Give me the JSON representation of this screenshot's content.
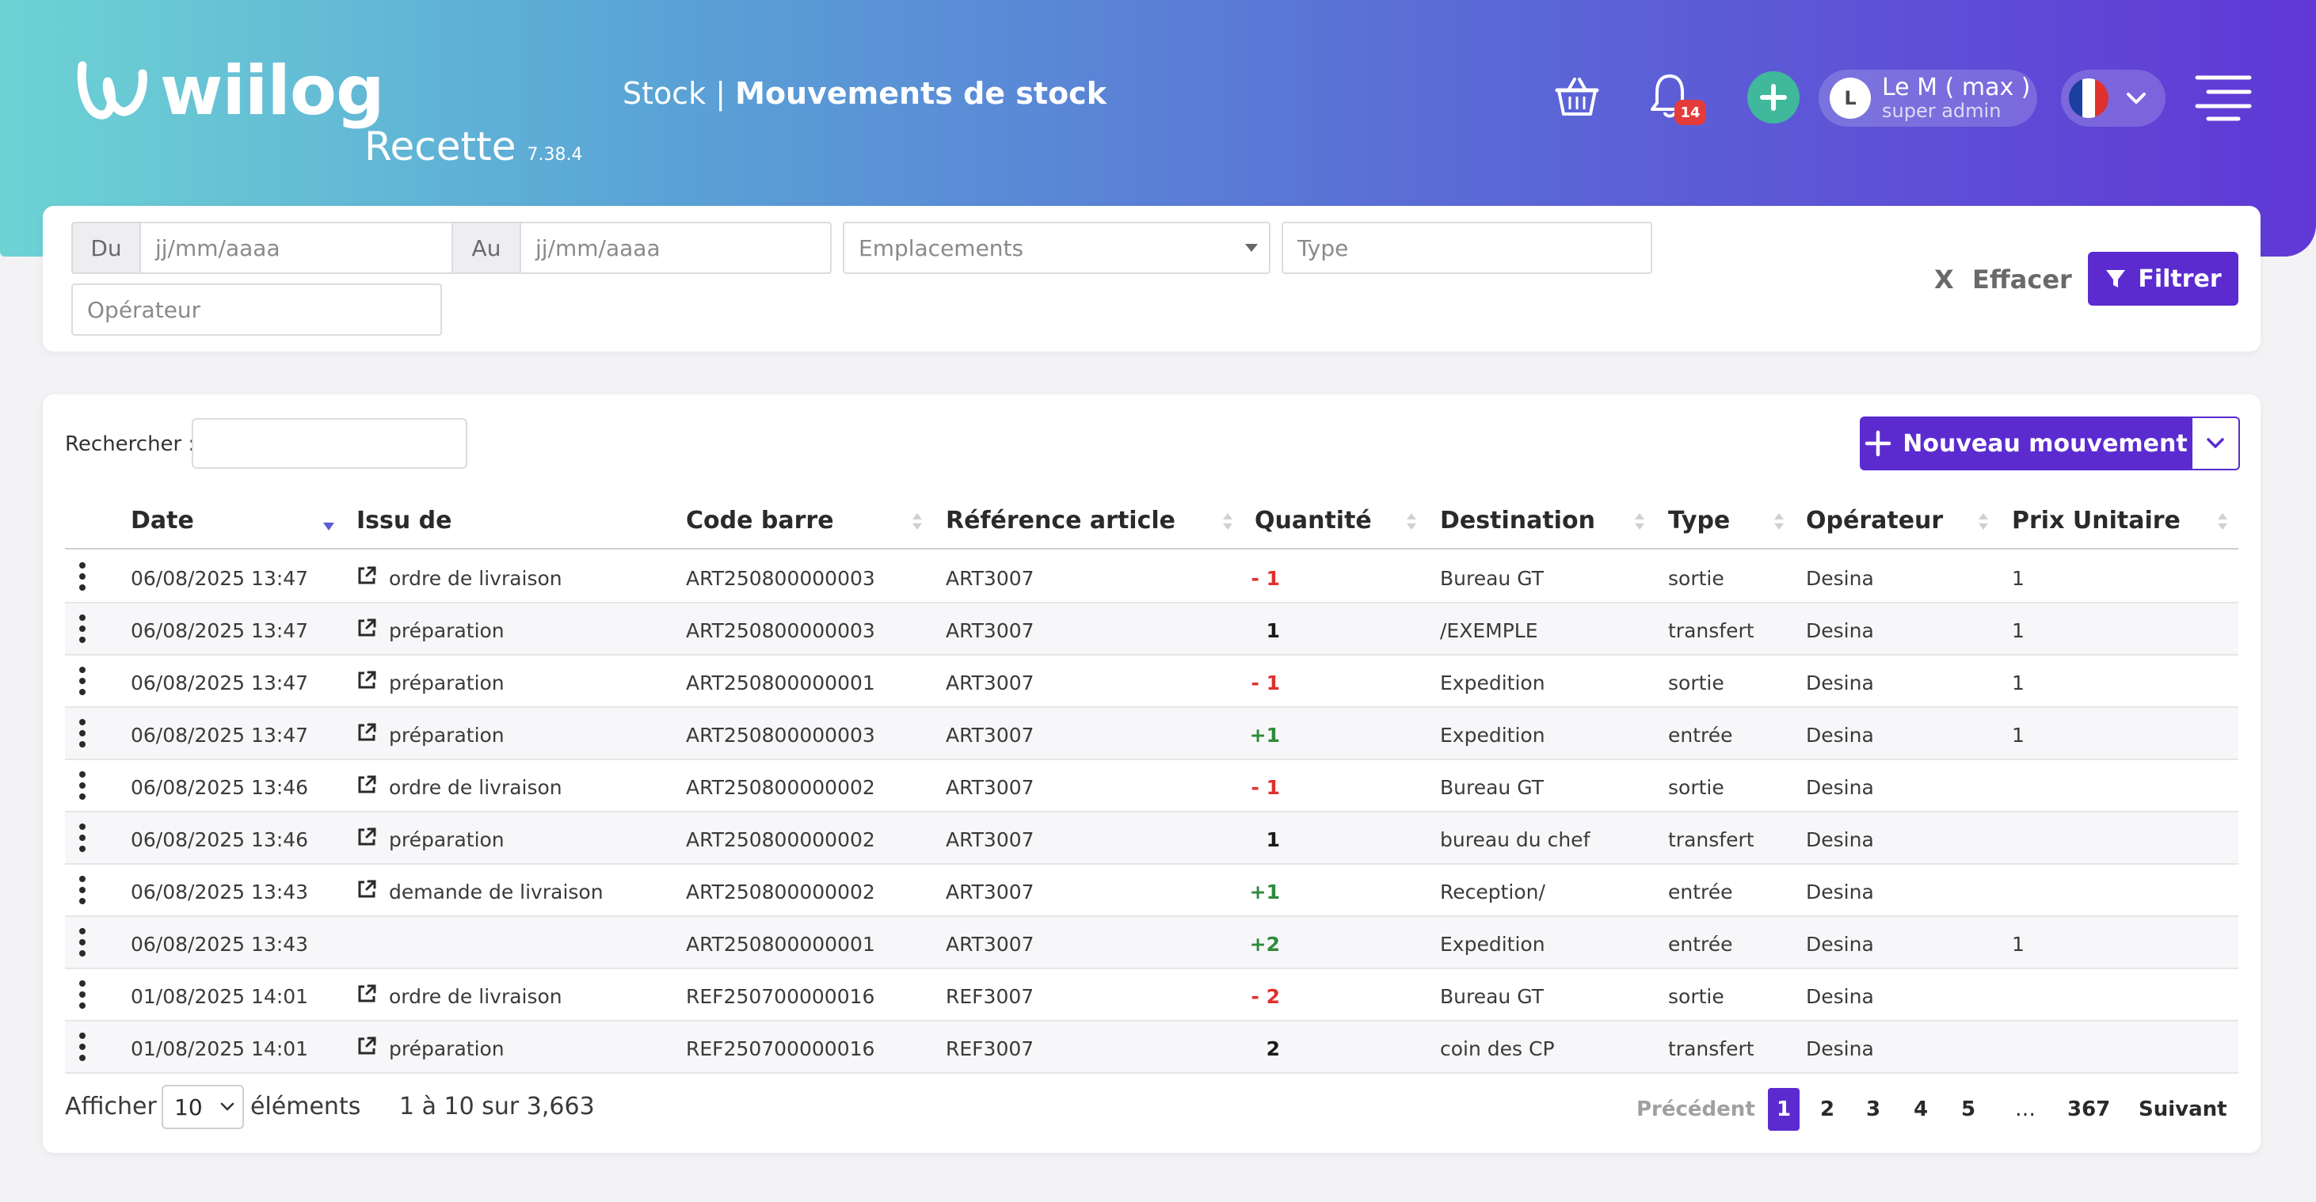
{
  "header": {
    "brand": "wiilog",
    "environment": "Recette",
    "version": "7.38.4",
    "section": "Stock",
    "separator": " | ",
    "page_title": "Mouvements de stock",
    "notification_count": "14",
    "user": {
      "initial": "L",
      "name": "Le M ( max )",
      "role": "super admin"
    },
    "icons": [
      "basket-icon",
      "bell-icon",
      "plus-icon",
      "flag-fr-icon",
      "chevron-down-icon",
      "menu-icon"
    ]
  },
  "filters": {
    "from_label": "Du",
    "from_placeholder": "jj/mm/aaaa",
    "to_label": "Au",
    "to_placeholder": "jj/mm/aaaa",
    "locations_placeholder": "Emplacements",
    "type_placeholder": "Type",
    "operator_placeholder": "Opérateur",
    "clear_x": "X",
    "clear_label": "Effacer",
    "filter_label": "Filtrer"
  },
  "table": {
    "search_label": "Rechercher :",
    "new_button_label": "Nouveau mouvement",
    "columns": [
      "Date",
      "Issu de",
      "Code barre",
      "Référence article",
      "Quantité",
      "Destination",
      "Type",
      "Opérateur",
      "Prix Unitaire"
    ],
    "rows": [
      {
        "date": "06/08/2025 13:47",
        "origin": "ordre de livraison",
        "barcode": "ART250800000003",
        "ref": "ART3007",
        "qty": "- 1",
        "qty_sign": "neg",
        "destination": "Bureau GT",
        "type": "sortie",
        "operator": "Desina",
        "price": "1"
      },
      {
        "date": "06/08/2025 13:47",
        "origin": "préparation",
        "barcode": "ART250800000003",
        "ref": "ART3007",
        "qty": "1",
        "qty_sign": "neu",
        "destination": "/EXEMPLE",
        "type": "transfert",
        "operator": "Desina",
        "price": "1"
      },
      {
        "date": "06/08/2025 13:47",
        "origin": "préparation",
        "barcode": "ART250800000001",
        "ref": "ART3007",
        "qty": "- 1",
        "qty_sign": "neg",
        "destination": "Expedition",
        "type": "sortie",
        "operator": "Desina",
        "price": "1"
      },
      {
        "date": "06/08/2025 13:47",
        "origin": "préparation",
        "barcode": "ART250800000003",
        "ref": "ART3007",
        "qty": "+1",
        "qty_sign": "pos",
        "destination": "Expedition",
        "type": "entrée",
        "operator": "Desina",
        "price": "1"
      },
      {
        "date": "06/08/2025 13:46",
        "origin": "ordre de livraison",
        "barcode": "ART250800000002",
        "ref": "ART3007",
        "qty": "- 1",
        "qty_sign": "neg",
        "destination": "Bureau GT",
        "type": "sortie",
        "operator": "Desina",
        "price": ""
      },
      {
        "date": "06/08/2025 13:46",
        "origin": "préparation",
        "barcode": "ART250800000002",
        "ref": "ART3007",
        "qty": "1",
        "qty_sign": "neu",
        "destination": "bureau du chef",
        "type": "transfert",
        "operator": "Desina",
        "price": ""
      },
      {
        "date": "06/08/2025 13:43",
        "origin": "demande de livraison",
        "barcode": "ART250800000002",
        "ref": "ART3007",
        "qty": "+1",
        "qty_sign": "pos",
        "destination": "Reception/",
        "type": "entrée",
        "operator": "Desina",
        "price": ""
      },
      {
        "date": "06/08/2025 13:43",
        "origin": "",
        "barcode": "ART250800000001",
        "ref": "ART3007",
        "qty": "+2",
        "qty_sign": "pos",
        "destination": "Expedition",
        "type": "entrée",
        "operator": "Desina",
        "price": "1"
      },
      {
        "date": "01/08/2025 14:01",
        "origin": "ordre de livraison",
        "barcode": "REF250700000016",
        "ref": "REF3007",
        "qty": "- 2",
        "qty_sign": "neg",
        "destination": "Bureau GT",
        "type": "sortie",
        "operator": "Desina",
        "price": ""
      },
      {
        "date": "01/08/2025 14:01",
        "origin": "préparation",
        "barcode": "REF250700000016",
        "ref": "REF3007",
        "qty": "2",
        "qty_sign": "neu",
        "destination": "coin des CP",
        "type": "transfert",
        "operator": "Desina",
        "price": ""
      }
    ]
  },
  "footer": {
    "show_label": "Afficher",
    "page_size": "10",
    "elements_label": "éléments",
    "info": "1 à 10 sur 3,663",
    "prev": "Précédent",
    "pages": [
      "1",
      "2",
      "3",
      "4",
      "5",
      "…",
      "367"
    ],
    "next": "Suivant"
  },
  "colors": {
    "accent": "#5b2bd0",
    "negative": "#e0312f",
    "positive": "#2e8b3a",
    "badge": "#e43b3b",
    "add": "#3fb89c"
  }
}
